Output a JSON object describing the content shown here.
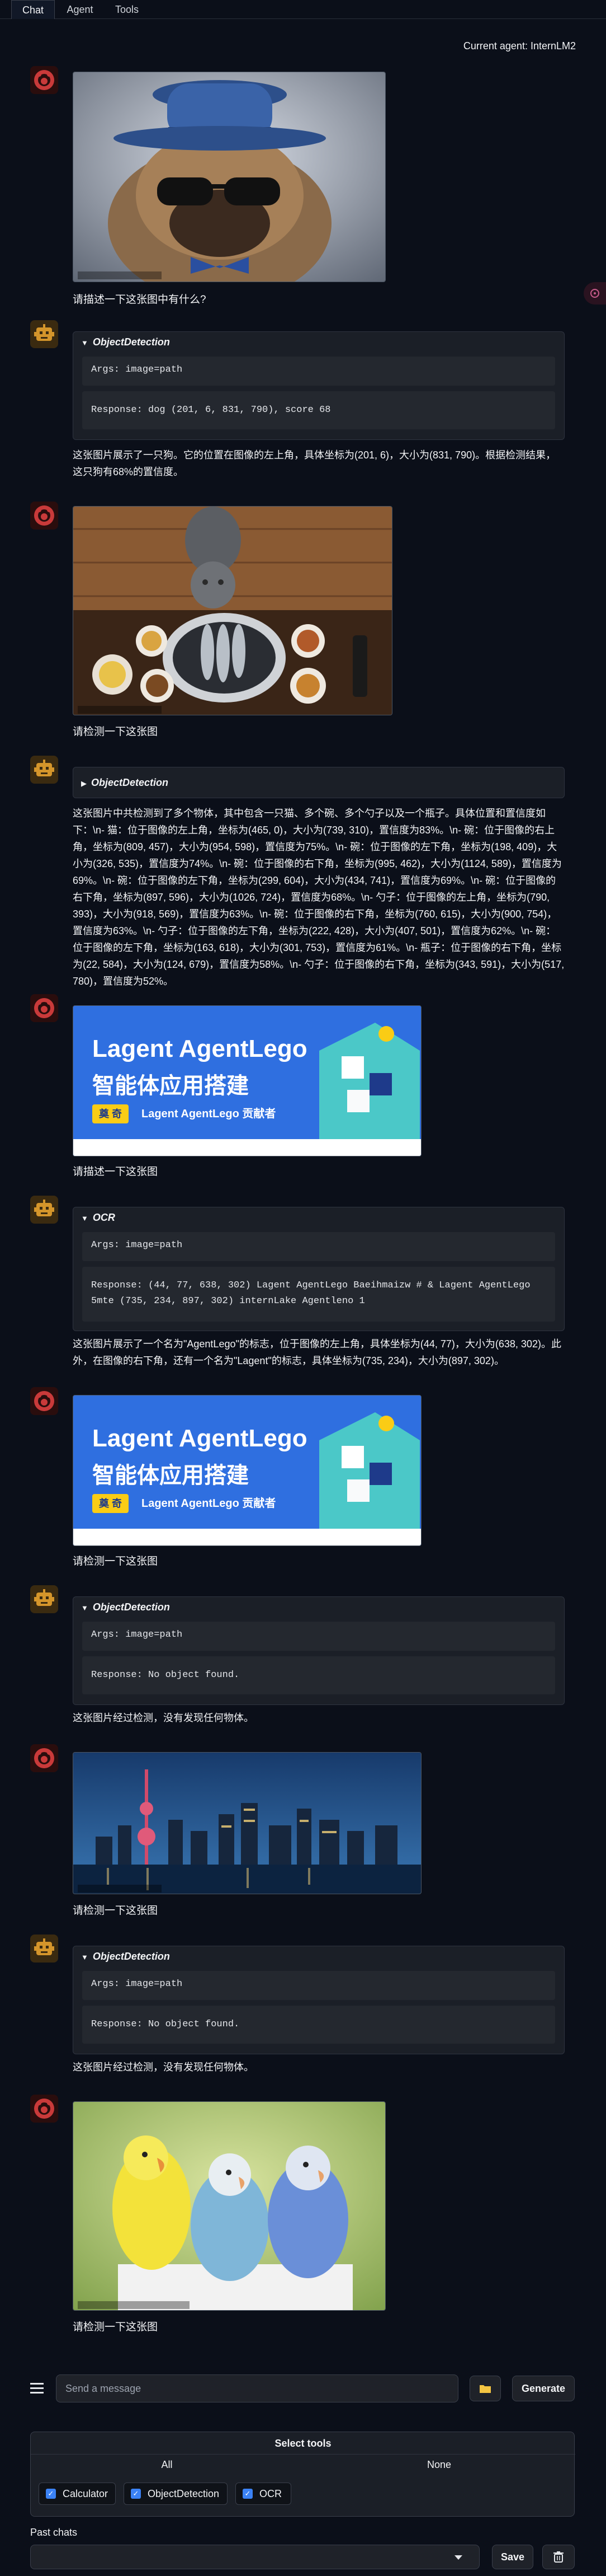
{
  "tabs": [
    {
      "label": "Chat"
    },
    {
      "label": "Agent"
    },
    {
      "label": "Tools"
    }
  ],
  "current_agent": "Current agent: InternLM2",
  "messages": {
    "q1": "请描述一下这张图中有什么?",
    "t1": {
      "name": "ObjectDetection",
      "args": "Args: image=path",
      "response": "Response: dog (201, 6, 831, 790), score 68"
    },
    "a1": "这张图片展示了一只狗。它的位置在图像的左上角，具体坐标为(201, 6)，大小为(831, 790)。根据检测结果，这只狗有68%的置信度。",
    "q2": "请检测一下这张图",
    "t2": {
      "name": "ObjectDetection"
    },
    "a2": "这张图片中共检测到了多个物体，其中包含一只猫、多个碗、多个勺子以及一个瓶子。具体位置和置信度如下：\\n- 猫：位于图像的左上角，坐标为(465, 0)，大小为(739, 310)，置信度为83%。\\n- 碗：位于图像的右上角，坐标为(809, 457)，大小为(954, 598)，置信度为75%。\\n- 碗：位于图像的左下角，坐标为(198, 409)，大小为(326, 535)，置信度为74%。\\n- 碗：位于图像的右下角，坐标为(995, 462)，大小为(1124, 589)，置信度为69%。\\n- 碗：位于图像的左下角，坐标为(299, 604)，大小为(434, 741)，置信度为69%。\\n- 碗：位于图像的右下角，坐标为(897, 596)，大小为(1026, 724)，置信度为68%。\\n- 勺子：位于图像的左上角，坐标为(790, 393)，大小为(918, 569)，置信度为63%。\\n- 碗：位于图像的右下角，坐标为(760, 615)，大小为(900, 754)，置信度为63%。\\n- 勺子：位于图像的左下角，坐标为(222, 428)，大小为(407, 501)，置信度为62%。\\n- 碗：位于图像的左下角，坐标为(163, 618)，大小为(301, 753)，置信度为61%。\\n- 瓶子：位于图像的右下角，坐标为(22, 584)，大小为(124, 679)，置信度为58%。\\n- 勺子：位于图像的右下角，坐标为(343, 591)，大小为(517, 780)，置信度为52%。",
    "q3": "请描述一下这张图",
    "t3": {
      "name": "OCR",
      "args": "Args: image=path",
      "response": "Response: (44, 77, 638, 302) Lagent AgentLego Baeihmaizw # & Lagent AgentLego 5mte (735, 234, 897, 302) internLake Agentleno 1"
    },
    "a3": "这张图片展示了一个名为\"AgentLego\"的标志，位于图像的左上角，具体坐标为(44, 77)，大小为(638, 302)。此外，在图像的右下角，还有一个名为\"Lagent\"的标志，具体坐标为(735, 234)，大小为(897, 302)。",
    "q4": "请检测一下这张图",
    "t4": {
      "name": "ObjectDetection",
      "args": "Args: image=path",
      "response": "Response: No object found."
    },
    "a4": "这张图片经过检测，没有发现任何物体。",
    "q5": "请检测一下这张图",
    "t5": {
      "name": "ObjectDetection",
      "args": "Args: image=path",
      "response": "Response: No object found."
    },
    "a5": "这张图片经过检测，没有发现任何物体。",
    "q6": "请检测一下这张图"
  },
  "banner": {
    "title": "Lagent AgentLego",
    "subtitle": "智能体应用搭建",
    "tag": "奠 奇",
    "tag_text": "Lagent AgentLego 贡献者"
  },
  "input": {
    "placeholder": "Send a message",
    "generate_label": "Generate"
  },
  "tools_panel": {
    "title": "Select tools",
    "all": "All",
    "none": "None",
    "tools": [
      {
        "label": "Calculator"
      },
      {
        "label": "ObjectDetection"
      },
      {
        "label": "OCR"
      }
    ]
  },
  "past": {
    "label": "Past chats",
    "save": "Save"
  },
  "colors": {
    "background": "#0b0f19",
    "panel": "#1b1f27",
    "checkbox": "#3b82f6",
    "user_avatar": "#d63a3a",
    "bot_avatar": "#d4952b"
  }
}
